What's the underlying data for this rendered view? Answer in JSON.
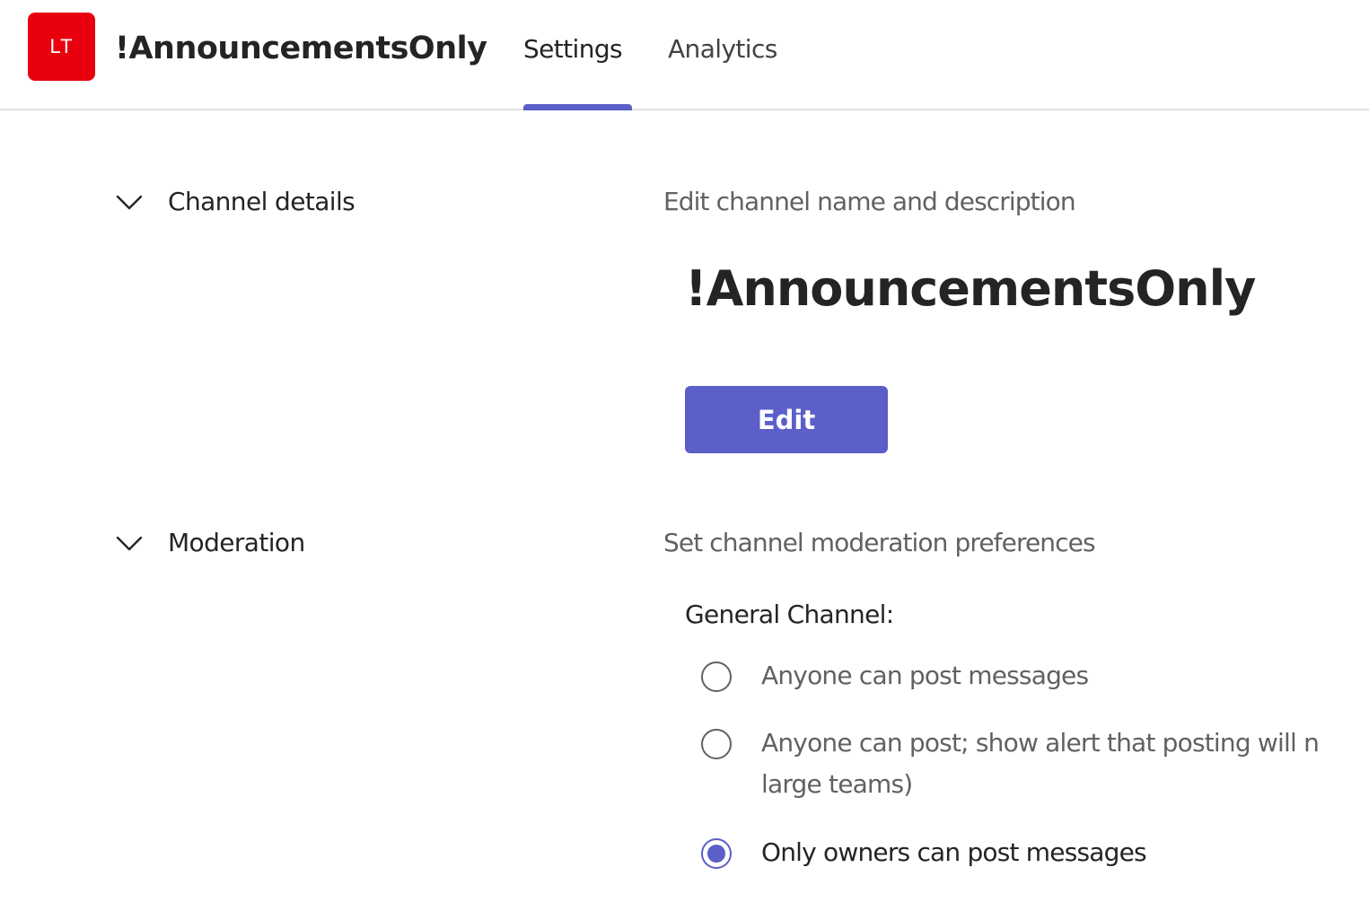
{
  "header": {
    "avatar_initials": "LT",
    "avatar_color": "#e8000f",
    "title": "!AnnouncementsOnly",
    "tabs": [
      {
        "label": "Settings",
        "active": true
      },
      {
        "label": "Analytics",
        "active": false
      }
    ],
    "accent_color": "#5b5fc7"
  },
  "sections": {
    "channel_details": {
      "label": "Channel details",
      "icon": "chevron-down-icon",
      "description": "Edit channel name and description",
      "channel_name": "!AnnouncementsOnly",
      "edit_label": "Edit"
    },
    "moderation": {
      "label": "Moderation",
      "icon": "chevron-down-icon",
      "description": "Set channel moderation preferences",
      "general_channel_label": "General Channel:",
      "options": [
        {
          "label": "Anyone can post messages",
          "selected": false
        },
        {
          "label": "Anyone can post; show alert that posting will n",
          "label_line2": "large teams)",
          "selected": false
        },
        {
          "label": "Only owners can post messages",
          "selected": true
        }
      ]
    }
  }
}
